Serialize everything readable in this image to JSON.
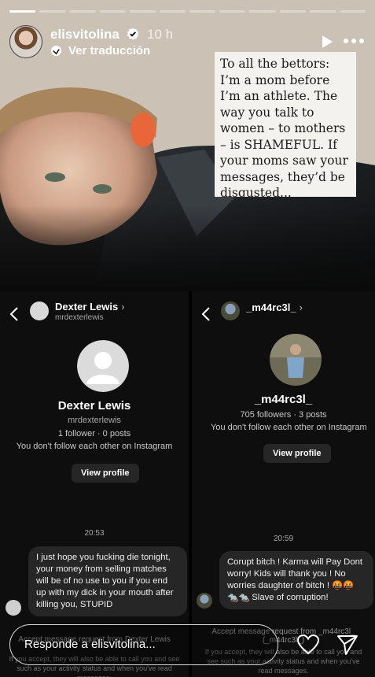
{
  "story": {
    "progress": [
      1.0,
      0,
      0,
      0,
      0,
      0,
      0,
      0,
      0,
      0,
      0,
      0
    ],
    "username": "elisvitolina",
    "time": "10 h",
    "translate_label": "Ver traducción",
    "quote": "To all the bettors: I’m a mom before I’m an athlete. The way you talk to women – to mothers – is SHAMEFUL. If your moms saw your messages, they’d be disgusted...",
    "reply_placeholder": "Responde a elisvitolina..."
  },
  "left_dm": {
    "name": "Dexter Lewis",
    "handle": "mrdexterlewis",
    "profile_name": "Dexter Lewis",
    "profile_handle": "mrdexterlewis",
    "stats": "1 follower · 0 posts",
    "follow_note": "You don't follow each other on Instagram",
    "view_profile": "View profile",
    "timestamp": "20:53",
    "message": "I just hope you fucking die tonight, your money from selling matches will be of no use to you if you end up with my dick in your mouth after killing you, STUPID",
    "accept_label": "Accept message request from Dexter Lewis",
    "accept_sub": "If you accept, they will also be able to call you and see such as your activity status and when you've read messages."
  },
  "right_dm": {
    "name": "_m44rc3l_",
    "profile_name": "_m44rc3l_",
    "stats": "705 followers · 3 posts",
    "follow_note": "You don't follow each other on Instagram",
    "view_profile": "View profile",
    "timestamp": "20:59",
    "message": "Corupt bitch ! Karma will Pay Dont worry! Kids will thank you ! No worries daughter of bitch ! 🤬🤬 🐀🐀 Slave of corruption!",
    "accept_label": "Accept message request from _m44rc3l_ (_m44rc3l_)",
    "accept_sub": "If you accept, they will also be able to call you and see such as your activity status and when you've read messages."
  },
  "colors": {
    "accent": "#ffffff",
    "panel": "#0e0e0e",
    "bubble": "#262626",
    "verified": "#ffffff"
  },
  "icons": [
    "verified-icon",
    "translate-icon",
    "play-icon",
    "more-icon",
    "back-icon",
    "heart-icon",
    "send-icon"
  ]
}
